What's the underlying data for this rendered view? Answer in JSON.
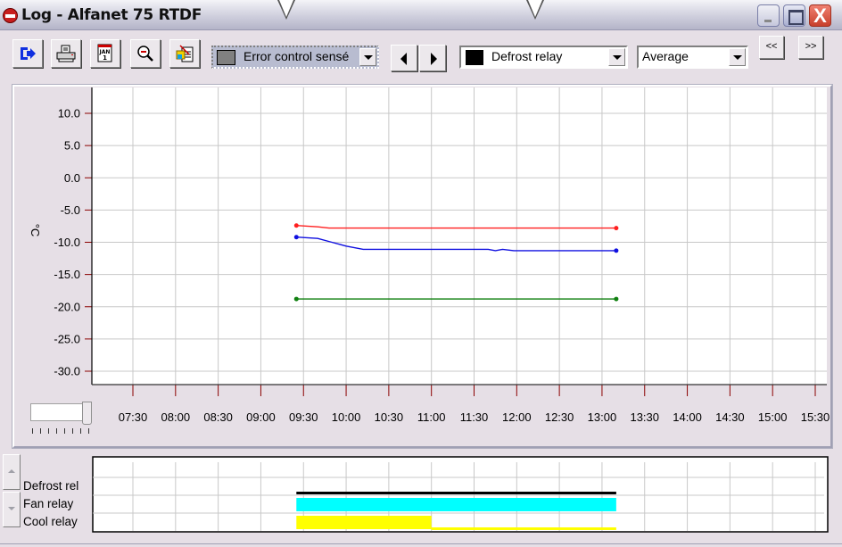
{
  "window": {
    "title": "Log - Alfanet 75 RTDF",
    "controls": [
      "minimize",
      "maximize",
      "close"
    ],
    "close_glyph": "X"
  },
  "toolbar": {
    "buttons": [
      {
        "name": "exit",
        "icon": "exit-arrow-icon"
      },
      {
        "name": "print",
        "icon": "printer-icon"
      },
      {
        "name": "calendar",
        "icon": "calendar-icon"
      },
      {
        "name": "zoom",
        "icon": "magnifier-icon"
      },
      {
        "name": "export",
        "icon": "export-document-icon"
      }
    ],
    "calendar_text": "JAN",
    "calendar_day": "1",
    "sensor_select": {
      "value": "Error control sensé",
      "swatch_color": "#808080"
    },
    "relay_select": {
      "value": "Defrost relay",
      "swatch_color": "#000000"
    },
    "mode_select": {
      "value": "Average"
    },
    "page_prev_label": "<<",
    "page_next_label": ">>"
  },
  "chart_data": {
    "type": "line",
    "title": "",
    "xlabel": "",
    "ylabel": "°C",
    "y_ticks": [
      "10.0",
      "5.0",
      "0.0",
      "-5.0",
      "-10.0",
      "-15.0",
      "-20.0",
      "-25.0",
      "-30.0"
    ],
    "ylim": [
      -32,
      12
    ],
    "x_ticks": [
      "07:30",
      "08:00",
      "08:30",
      "09:00",
      "09:30",
      "10:00",
      "10:30",
      "11:00",
      "11:30",
      "12:00",
      "12:30",
      "13:00",
      "13:30",
      "14:00",
      "14:30",
      "15:00",
      "15:30"
    ],
    "xlim_minutes": [
      405,
      947
    ],
    "grid": true,
    "series": [
      {
        "name": "red-sensor",
        "color": "#ff2020",
        "points": [
          [
            565,
            -7.4
          ],
          [
            580,
            -7.6
          ],
          [
            588,
            -7.8
          ],
          [
            790,
            -7.8
          ]
        ]
      },
      {
        "name": "blue-sensor",
        "color": "#1010e0",
        "points": [
          [
            565,
            -9.2
          ],
          [
            580,
            -9.4
          ],
          [
            590,
            -10.0
          ],
          [
            600,
            -10.6
          ],
          [
            612,
            -11.1
          ],
          [
            700,
            -11.1
          ],
          [
            705,
            -11.3
          ],
          [
            710,
            -11.1
          ],
          [
            718,
            -11.3
          ],
          [
            790,
            -11.3
          ]
        ]
      },
      {
        "name": "green-sensor",
        "color": "#108010",
        "points": [
          [
            565,
            -18.8
          ],
          [
            790,
            -18.8
          ]
        ]
      }
    ]
  },
  "zoom_slider": {
    "value_fraction": 1.0,
    "tick_count": 8
  },
  "relays": {
    "labels": [
      "Defrost rel",
      "Fan relay",
      "Cool relay"
    ],
    "bars": [
      {
        "name": "defrost",
        "color": "#000000",
        "segments": [
          {
            "start": 565,
            "end": 790,
            "level": "low"
          }
        ]
      },
      {
        "name": "fan",
        "color": "#00ffff",
        "segments": [
          {
            "start": 565,
            "end": 790,
            "level": "full"
          }
        ]
      },
      {
        "name": "cool",
        "color": "#ffff00",
        "segments": [
          {
            "start": 565,
            "end": 660,
            "level": "full"
          },
          {
            "start": 660,
            "end": 790,
            "level": "low"
          }
        ]
      }
    ]
  }
}
